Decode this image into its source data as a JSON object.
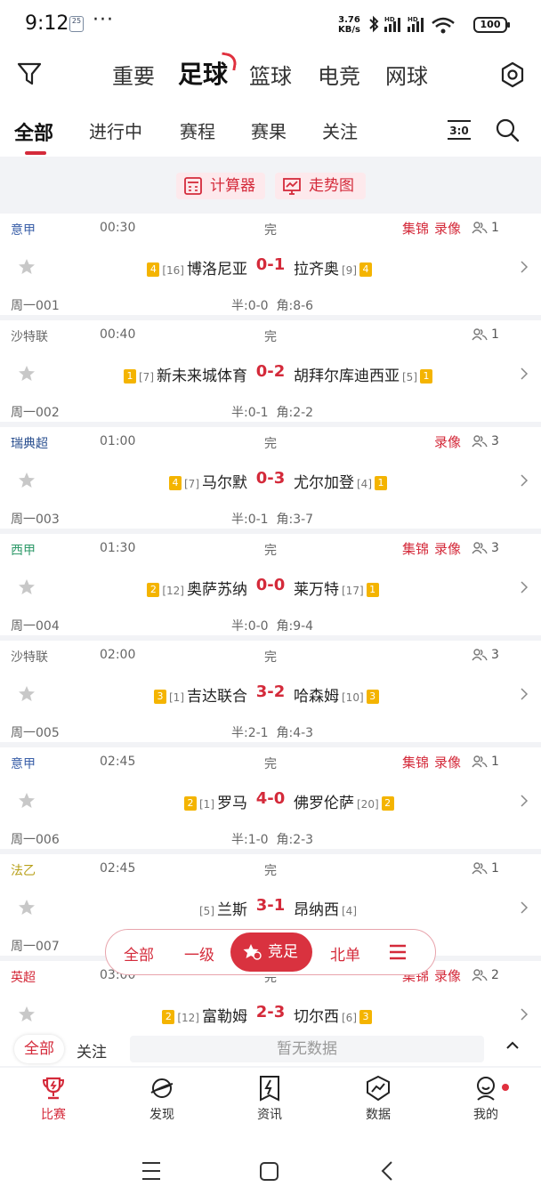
{
  "status_bar": {
    "time": "9:12",
    "badge": "25",
    "net_speed_value": "3.76",
    "net_speed_unit": "KB/s",
    "battery": "100"
  },
  "sport_tabs": [
    "重要",
    "足球",
    "篮球",
    "电竞",
    "网球"
  ],
  "sub_tabs": [
    "全部",
    "进行中",
    "赛程",
    "赛果",
    "关注"
  ],
  "score_icon_text": "3:0",
  "tools": {
    "calculator": "计算器",
    "trend": "走势图"
  },
  "matches": [
    {
      "league": "意甲",
      "league_color": "#3a5fa8",
      "time": "00:30",
      "status": "完",
      "highlights": "集锦",
      "replay": "录像",
      "viewers": "1",
      "home_card": "4",
      "home_rank": "[16]",
      "home": "博洛尼亚",
      "score": "0-1",
      "away": "拉齐奥",
      "away_rank": "[9]",
      "away_card": "4",
      "code": "周一001",
      "half": "半:0-0",
      "corner": "角:8-6"
    },
    {
      "league": "沙特联",
      "league_color": "#666666",
      "time": "00:40",
      "status": "完",
      "highlights": "",
      "replay": "",
      "viewers": "1",
      "home_card": "1",
      "home_rank": "[7]",
      "home": "新未来城体育",
      "score": "0-2",
      "away": "胡拜尔库迪西亚",
      "away_rank": "[5]",
      "away_card": "1",
      "code": "周一002",
      "half": "半:0-1",
      "corner": "角:2-2"
    },
    {
      "league": "瑞典超",
      "league_color": "#2a4f8f",
      "time": "01:00",
      "status": "完",
      "highlights": "",
      "replay": "录像",
      "viewers": "3",
      "home_card": "4",
      "home_rank": "[7]",
      "home": "马尔默",
      "score": "0-3",
      "away": "尤尔加登",
      "away_rank": "[4]",
      "away_card": "1",
      "code": "周一003",
      "half": "半:0-1",
      "corner": "角:3-7"
    },
    {
      "league": "西甲",
      "league_color": "#2f9a6a",
      "time": "01:30",
      "status": "完",
      "highlights": "集锦",
      "replay": "录像",
      "viewers": "3",
      "home_card": "2",
      "home_rank": "[12]",
      "home": "奥萨苏纳",
      "score": "0-0",
      "away": "莱万特",
      "away_rank": "[17]",
      "away_card": "1",
      "code": "周一004",
      "half": "半:0-0",
      "corner": "角:9-4"
    },
    {
      "league": "沙特联",
      "league_color": "#666666",
      "time": "02:00",
      "status": "完",
      "highlights": "",
      "replay": "",
      "viewers": "3",
      "home_card": "3",
      "home_rank": "[1]",
      "home": "吉达联合",
      "score": "3-2",
      "away": "哈森姆",
      "away_rank": "[10]",
      "away_card": "3",
      "code": "周一005",
      "half": "半:2-1",
      "corner": "角:4-3"
    },
    {
      "league": "意甲",
      "league_color": "#3a5fa8",
      "time": "02:45",
      "status": "完",
      "highlights": "集锦",
      "replay": "录像",
      "viewers": "1",
      "home_card": "2",
      "home_rank": "[1]",
      "home": "罗马",
      "score": "4-0",
      "away": "佛罗伦萨",
      "away_rank": "[20]",
      "away_card": "2",
      "code": "周一006",
      "half": "半:1-0",
      "corner": "角:2-3"
    },
    {
      "league": "法乙",
      "league_color": "#b8a01a",
      "time": "02:45",
      "status": "完",
      "highlights": "",
      "replay": "",
      "viewers": "1",
      "home_card": "",
      "home_rank": "[5]",
      "home": "兰斯",
      "score": "3-1",
      "away": "昂纳西",
      "away_rank": "[4]",
      "away_card": "",
      "code": "周一007",
      "half": "",
      "corner": ""
    },
    {
      "league": "英超",
      "league_color": "#d42a3a",
      "time": "03:00",
      "status": "完",
      "highlights": "集锦",
      "replay": "录像",
      "viewers": "2",
      "home_card": "2",
      "home_rank": "[12]",
      "home": "富勒姆",
      "score": "2-3",
      "away": "切尔西",
      "away_rank": "[6]",
      "away_card": "3",
      "code": "",
      "half": "",
      "corner": ""
    }
  ],
  "float_filter": {
    "all": "全部",
    "level1": "一级",
    "jingzu": "竞足",
    "beidan": "北单"
  },
  "bottom_filter": {
    "all": "全部",
    "follow": "关注",
    "no_data": "暂无数据"
  },
  "tab_bar": [
    "比赛",
    "发现",
    "资讯",
    "数据",
    "我的"
  ],
  "colors": {
    "accent": "#d42a3a",
    "card_yellow": "#f4b400"
  }
}
